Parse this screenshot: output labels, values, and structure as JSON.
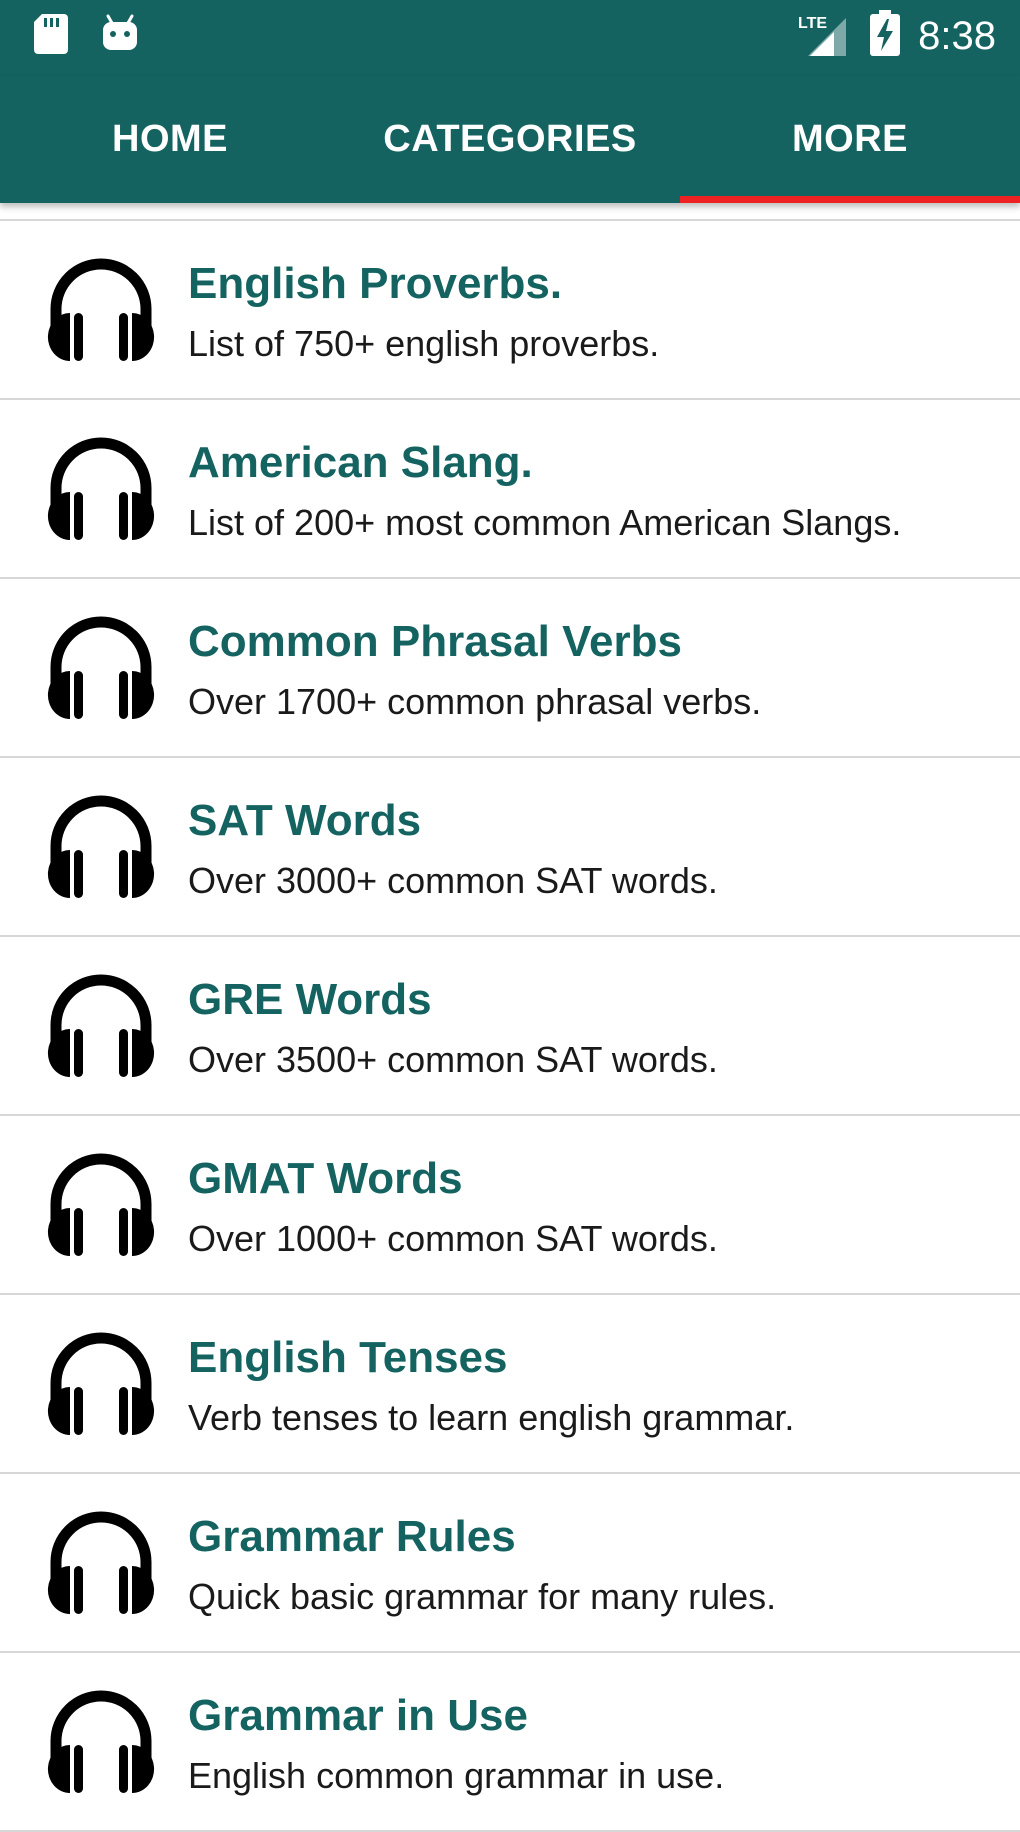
{
  "status_bar": {
    "time": "8:38",
    "network": "LTE",
    "icons": [
      "sd-card-icon",
      "android-icon",
      "lte-signal-icon",
      "battery-charging-icon"
    ]
  },
  "tabs": [
    {
      "label": "HOME",
      "selected": false
    },
    {
      "label": "CATEGORIES",
      "selected": false
    },
    {
      "label": "MORE",
      "selected": true
    }
  ],
  "colors": {
    "primary": "#146361",
    "indicator": "#ee2222",
    "divider": "#d7d7d7",
    "title_text": "#146361",
    "subtitle_text": "#1a1a1a"
  },
  "items": [
    {
      "icon": "headphones-icon",
      "title": "English Proverbs.",
      "subtitle": "List of 750+ english proverbs."
    },
    {
      "icon": "headphones-icon",
      "title": "American Slang.",
      "subtitle": "List of 200+ most common American Slangs."
    },
    {
      "icon": "headphones-icon",
      "title": "Common Phrasal Verbs",
      "subtitle": "Over 1700+ common phrasal verbs."
    },
    {
      "icon": "headphones-icon",
      "title": "SAT Words",
      "subtitle": "Over 3000+ common SAT words."
    },
    {
      "icon": "headphones-icon",
      "title": "GRE Words",
      "subtitle": "Over 3500+ common SAT words."
    },
    {
      "icon": "headphones-icon",
      "title": "GMAT Words",
      "subtitle": "Over 1000+ common SAT words."
    },
    {
      "icon": "headphones-icon",
      "title": "English Tenses",
      "subtitle": "Verb tenses to learn english grammar."
    },
    {
      "icon": "headphones-icon",
      "title": "Grammar Rules",
      "subtitle": "Quick basic grammar for many rules."
    },
    {
      "icon": "headphones-icon",
      "title": "Grammar in Use",
      "subtitle": "English common grammar in use."
    }
  ]
}
